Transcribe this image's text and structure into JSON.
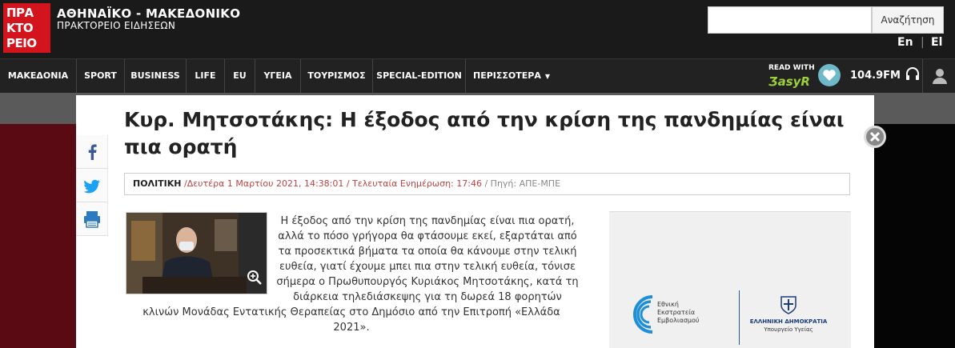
{
  "header": {
    "logo_lines": [
      "ΠΡΑ",
      "ΚΤΟ",
      "ΡΕΙΟ"
    ],
    "brand_title": "ΑΘΗΝΑΪΚΟ - ΜΑΚΕΔΟΝΙΚΟ",
    "brand_subtitle": "ΠΡΑΚΤΟΡΕΙΟ ΕΙΔΗΣΕΩΝ",
    "search_placeholder": "",
    "search_button": "Αναζήτηση",
    "lang_en": "En",
    "lang_sep": "|",
    "lang_el": "El"
  },
  "nav": {
    "items": [
      {
        "label": "ΜΑΚΕΔΟΝΙΑ"
      },
      {
        "label": "SPORT"
      },
      {
        "label": "BUSINESS"
      },
      {
        "label": "LIFE"
      },
      {
        "label": "EU"
      },
      {
        "label": "ΥΓΕΙΑ"
      },
      {
        "label": "ΤΟΥΡΙΣΜΟΣ"
      },
      {
        "label": "SPECIAL-EDITION"
      },
      {
        "label": "ΠΕΡΙΣΣΟΤΕΡΑ"
      }
    ],
    "read_with": "READ WITH",
    "easyr": "ƷasyR",
    "radio": "104.9FM"
  },
  "article": {
    "title": "Κυρ. Μητσοτάκης: Η έξοδος από την κρίση της πανδημίας είναι πια ορατή",
    "category": "ΠΟΛΙΤΙΚΗ",
    "date": "/Δευτέρα 1 Μαρτίου 2021, 14:38:01 / Τελευταία Ενημέρωση: 17:46",
    "source": "/ Πηγή: ΑΠΕ-ΜΠΕ",
    "body": "Η έξοδος από την κρίση της πανδημίας είναι πια ορατή, αλλά το πόσο γρήγορα θα φτάσουμε εκεί, εξαρτάται από τα προσεκτικά βήματα τα οποία θα κάνουμε στην τελική ευθεία, γιατί έχουμε μπει πια στην τελική ευθεία, τόνισε σήμερα ο Πρωθυπουργός Κυριάκος Μητσοτάκης, κατά τη διάρκεια τηλεδιάσκεψης για τη δωρεά 18 φορητών κλινών Μονάδας Εντατικής Θεραπείας στο Δημόσιο από την Επιτροπή «Ελλάδα 2021»."
  },
  "ad": {
    "campaign_text": [
      "Εθνική",
      "Εκστρατεία",
      "Εμβολιασμού"
    ],
    "republic": "ΕΛΛΗΝΙΚΗ ΔΗΜΟΚΡΑΤΙΑ",
    "ministry": "Υπουργείο Υγείας"
  },
  "colors": {
    "brand_red": "#d4141c",
    "nav_bg": "#222222",
    "meta_red": "#c14242"
  }
}
